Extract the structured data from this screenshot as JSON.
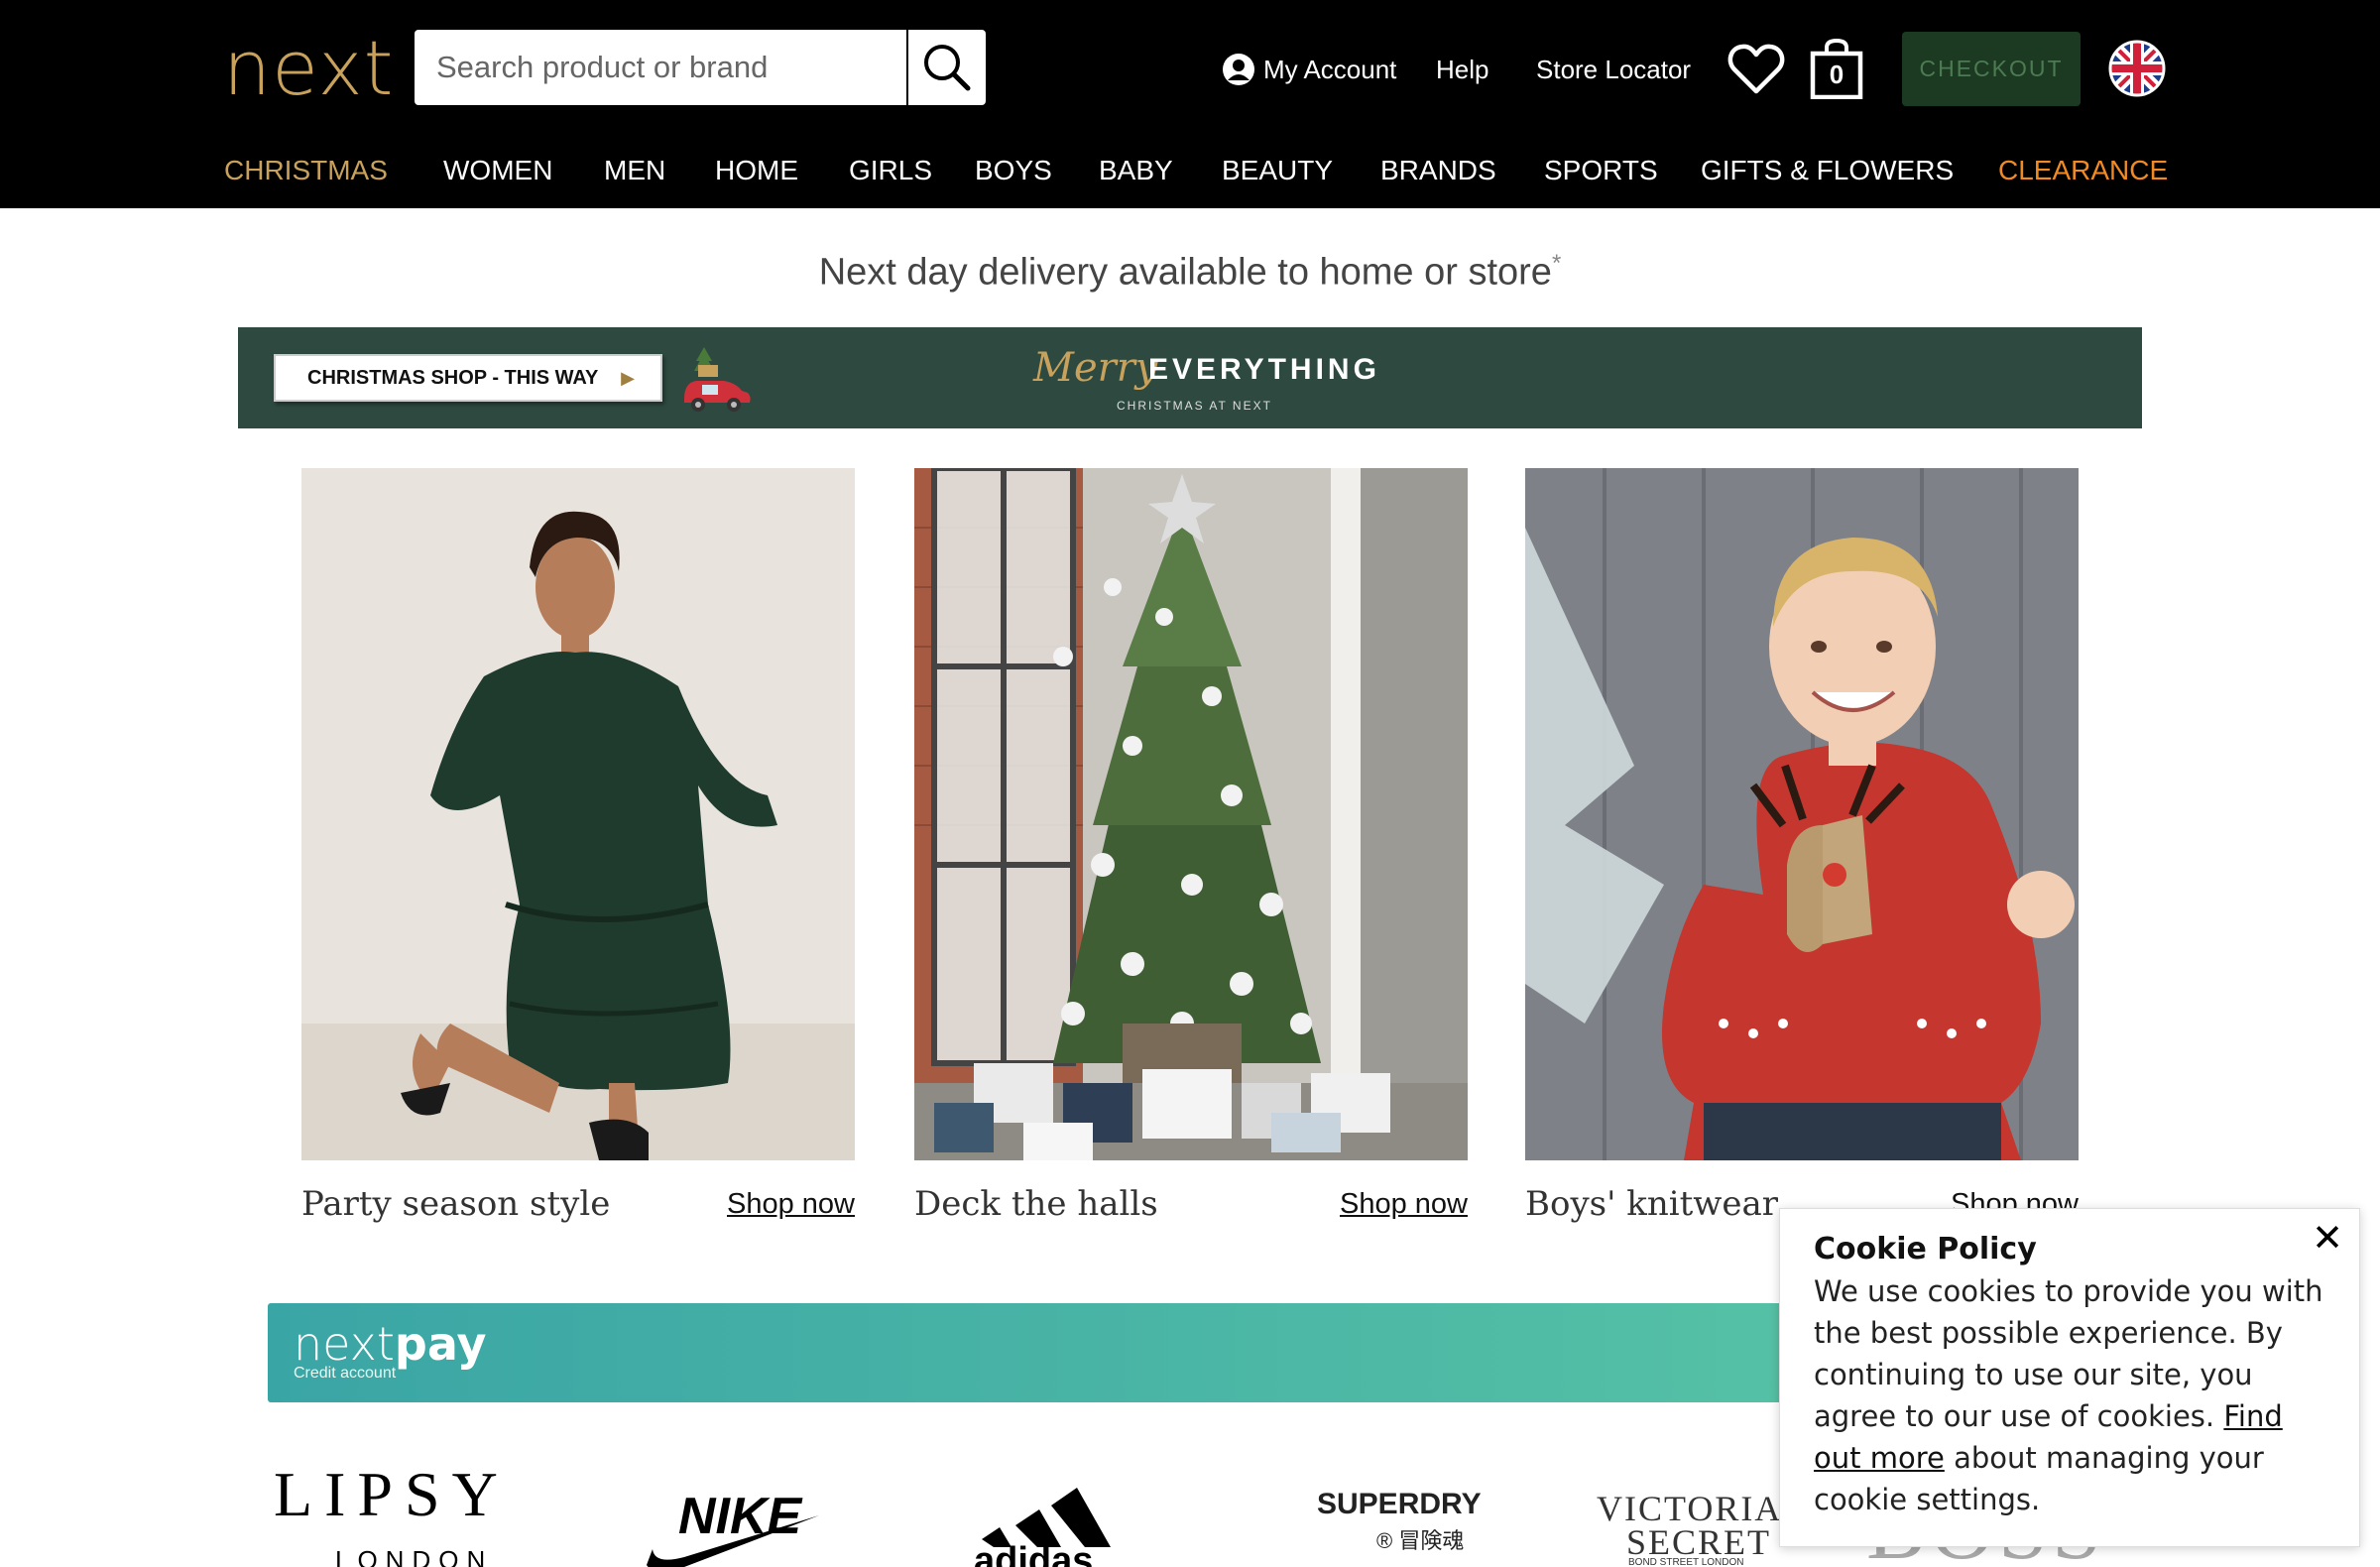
{
  "header": {
    "logo": "next",
    "search_placeholder": "Search product or brand",
    "my_account": "My Account",
    "help": "Help",
    "store_locator": "Store Locator",
    "bag_count": "0",
    "checkout": "CHECKOUT",
    "country_icon": "uk-flag-icon"
  },
  "nav": {
    "items": [
      "CHRISTMAS",
      "WOMEN",
      "MEN",
      "HOME",
      "GIRLS",
      "BOYS",
      "BABY",
      "BEAUTY",
      "BRANDS",
      "SPORTS",
      "GIFTS & FLOWERS",
      "CLEARANCE"
    ],
    "colors": {
      "christmas": "#c8a25c",
      "clearance": "#f08a24",
      "default": "#ffffff"
    }
  },
  "delivery": {
    "text": "Next day delivery available to home or store",
    "mark": "*"
  },
  "xmas_banner": {
    "button": "CHRISTMAS SHOP - THIS WAY",
    "merry": "Merry",
    "everything": "EVERYTHING",
    "sub": "CHRISTMAS AT NEXT",
    "color": "#2e4a40"
  },
  "cards": [
    {
      "caption": "Party season style",
      "link": "Shop now"
    },
    {
      "caption": "Deck the halls",
      "link": "Shop now"
    },
    {
      "caption": "Boys' knitwear",
      "link": "Shop now"
    }
  ],
  "nextpay": {
    "logo_thin": "next",
    "logo_bold": "pay",
    "sub": "Credit account"
  },
  "brands": {
    "lipsy": "LIPSY",
    "lipsy_sub": "LONDON",
    "nike": "NIKE",
    "adidas": "adidas",
    "superdry": "SUPERDRY",
    "superdry_sub": "® 冒険魂",
    "vs_line1": "VICTORIA'S",
    "vs_line2": "SECRET",
    "vs_line3": "BOND STREET LONDON",
    "boss": "BOSS"
  },
  "cookie": {
    "title": "Cookie Policy",
    "body": "We use cookies to provide you with the best possible experience. By continuing to use our site, you agree to our use of cookies.",
    "link": "Find out more",
    "tail": "about managing your cookie settings.",
    "close": "✕"
  }
}
